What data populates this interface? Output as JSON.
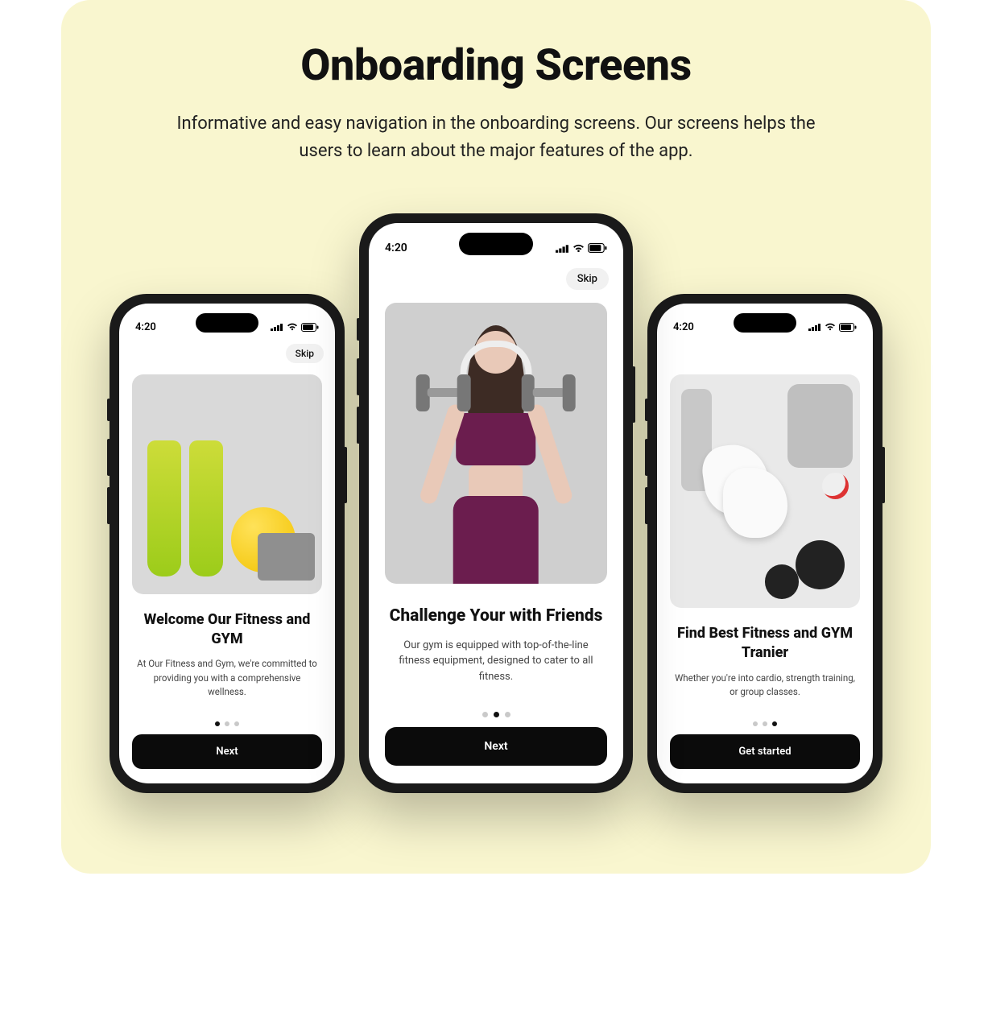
{
  "page": {
    "title": "Onboarding Screens",
    "subtitle": "Informative and easy navigation in the onboarding screens. Our screens helps the users to learn about the major features of the app."
  },
  "status": {
    "time": "4:20"
  },
  "skip_label": "Skip",
  "phones": [
    {
      "title": "Welcome Our Fitness and GYM",
      "desc": "At Our Fitness and Gym, we're committed to providing you with a comprehensive wellness.",
      "cta": "Next",
      "active_dot": 0,
      "show_skip": true,
      "image": "gym-gear-bottles-ball"
    },
    {
      "title": "Challenge Your with Friends",
      "desc": "Our gym is equipped with top-of-the-line fitness equipment, designed to cater to all fitness.",
      "cta": "Next",
      "active_dot": 1,
      "show_skip": true,
      "image": "woman-dumbbells-headphones"
    },
    {
      "title": "Find Best Fitness and GYM Tranier",
      "desc": "Whether you're into cardio, strength training, or group classes.",
      "cta": "Get started",
      "active_dot": 2,
      "show_skip": false,
      "image": "shoes-plates-bottle"
    }
  ]
}
